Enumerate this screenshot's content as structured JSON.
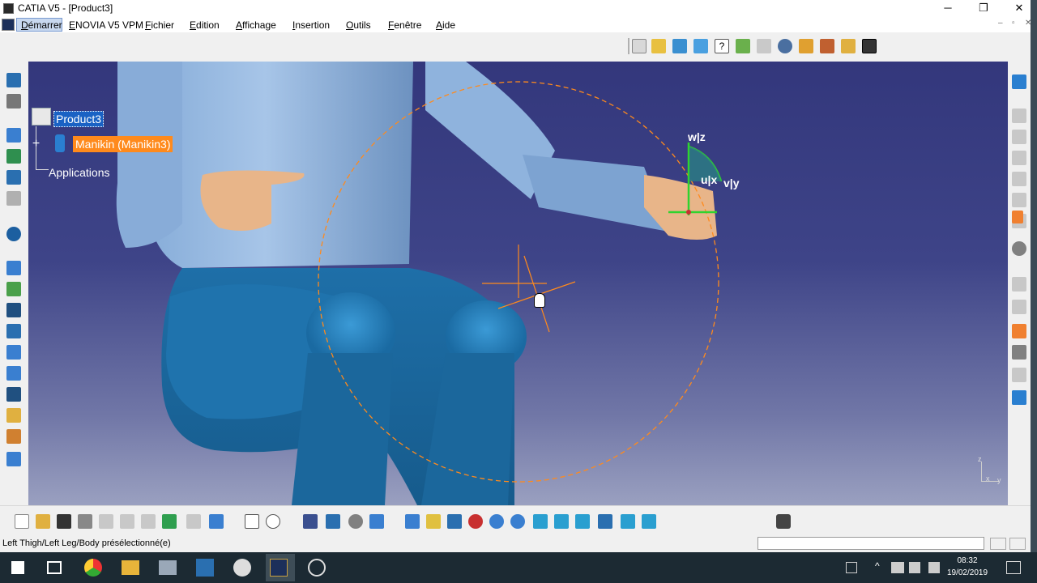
{
  "window": {
    "title": "CATIA V5 - [Product3]",
    "minimize": "─",
    "restore": "❐",
    "close": "✕"
  },
  "menu": {
    "items": [
      "Démarrer",
      "ENOVIA V5 VPM",
      "Fichier",
      "Edition",
      "Affichage",
      "Insertion",
      "Outils",
      "Fenêtre",
      "Aide"
    ],
    "mdi_minimize": "–",
    "mdi_restore": "▫",
    "mdi_close": "✕"
  },
  "tree": {
    "root": "Product3",
    "child": "Manikin (Manikin3)",
    "applications": "Applications"
  },
  "compass": {
    "label_wz": "w|z",
    "label_ux": "u|x",
    "label_vy": "v|y"
  },
  "axis": {
    "z": "z",
    "x": "x",
    "y": "y"
  },
  "status": {
    "message": "Left Thigh/Left Leg/Body présélectionné(e)",
    "command_value": ""
  },
  "taskbar": {
    "time": "08:32",
    "date": "19/02/2019"
  },
  "colors": {
    "viewport_top": "#33377c",
    "viewport_bottom": "#9aa0c0",
    "selection_blue": "#1a62c4",
    "highlight_orange": "#ff8a1c",
    "compass_green": "#2fd32f",
    "taskbar": "#1c2a33"
  },
  "icons": {
    "left_toolbar": [
      "manikin-posture-icon",
      "manikin-walk-icon",
      "constraint-icon",
      "fix-icon",
      "anchor-icon",
      "ruler-icon",
      "swirl-icon",
      "reach-icon",
      "ik-icon",
      "film-icon",
      "group-icon",
      "catalog-icon",
      "ik-chain-icon",
      "sequence-icon",
      "swap-icon",
      "hand-icon",
      "cube-icon"
    ],
    "right_toolbar": [
      "standard-pose-icon",
      "pose-1-icon",
      "pose-2-icon",
      "pose-3-icon",
      "pose-4-icon",
      "pose-5-icon",
      "pose-6-icon",
      "select-arrow-icon",
      "gear-hand-icon",
      "grip-icon",
      "reach-target-icon",
      "orange-figure-icon",
      "tool-icon",
      "figure-2-icon",
      "figure-3-icon",
      "group-figure-icon"
    ],
    "top_toolbar": [
      "insert-manikin-icon",
      "anthropometry-icon",
      "table-icon",
      "posture-icon",
      "help-query-icon",
      "vision-icon",
      "tools-icon",
      "eye-icon",
      "gestures-icon",
      "figures-icon",
      "folder-back-icon",
      "save-icon"
    ],
    "bottom_toolbar": [
      "new-icon",
      "open-icon",
      "save-icon",
      "print-icon",
      "cut-icon",
      "copy-icon",
      "paste-icon",
      "undo-icon",
      "redo-icon",
      "whats-this-icon",
      "formula-icon",
      "comment-icon",
      "table-icon",
      "tree-icon",
      "gear-icon",
      "layer-icon",
      "fly-icon",
      "fit-all-icon",
      "pan-icon",
      "rotate-icon",
      "zoom-in-icon",
      "zoom-out-icon",
      "normal-view-icon",
      "iso-view-icon",
      "cube-view-icon",
      "hide-show-icon",
      "swap-visible-icon",
      "render-icon",
      "camera-icon",
      "catia-logo"
    ]
  }
}
